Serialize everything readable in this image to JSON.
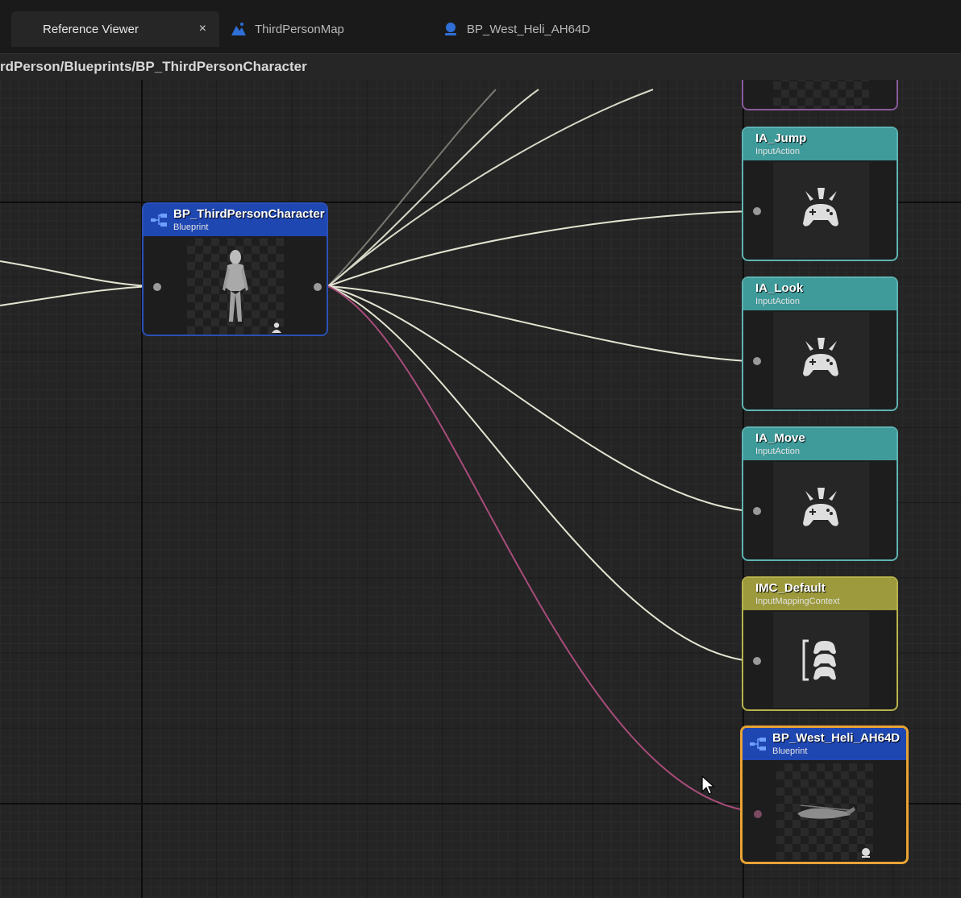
{
  "tabs": [
    {
      "label": "Reference Viewer",
      "active": true,
      "close": "×"
    },
    {
      "label": "ThirdPersonMap",
      "icon": "level-map-icon"
    },
    {
      "label": "BP_West_Heli_AH64D",
      "icon": "blueprint-sphere-icon"
    }
  ],
  "path": "rdPerson/Blueprints/BP_ThirdPersonCharacter",
  "nodes": {
    "root": {
      "title": "BP_ThirdPersonCharacter",
      "type": "Blueprint",
      "thumbnail": "mannequin-figure",
      "badge": "character-icon"
    },
    "ia_jump": {
      "title": "IA_Jump",
      "type": "InputAction",
      "icon": "gamepad-input-icon"
    },
    "ia_look": {
      "title": "IA_Look",
      "type": "InputAction",
      "icon": "gamepad-input-icon"
    },
    "ia_move": {
      "title": "IA_Move",
      "type": "InputAction",
      "icon": "gamepad-input-icon"
    },
    "imc_default": {
      "title": "IMC_Default",
      "type": "InputMappingContext",
      "icon": "mapping-context-icon"
    },
    "heli": {
      "title": "BP_West_Heli_AH64D",
      "type": "Blueprint",
      "thumbnail": "helicopter-model",
      "badge": "sphere-icon",
      "selected": true
    }
  },
  "colors": {
    "input_action": "#3f9a9a",
    "mapping_context": "#9c9a3c",
    "blueprint": "#1f47b2",
    "selection": "#e8a334",
    "hard_reference": "#e8e8d6",
    "soft_reference": "#a84c7a"
  }
}
